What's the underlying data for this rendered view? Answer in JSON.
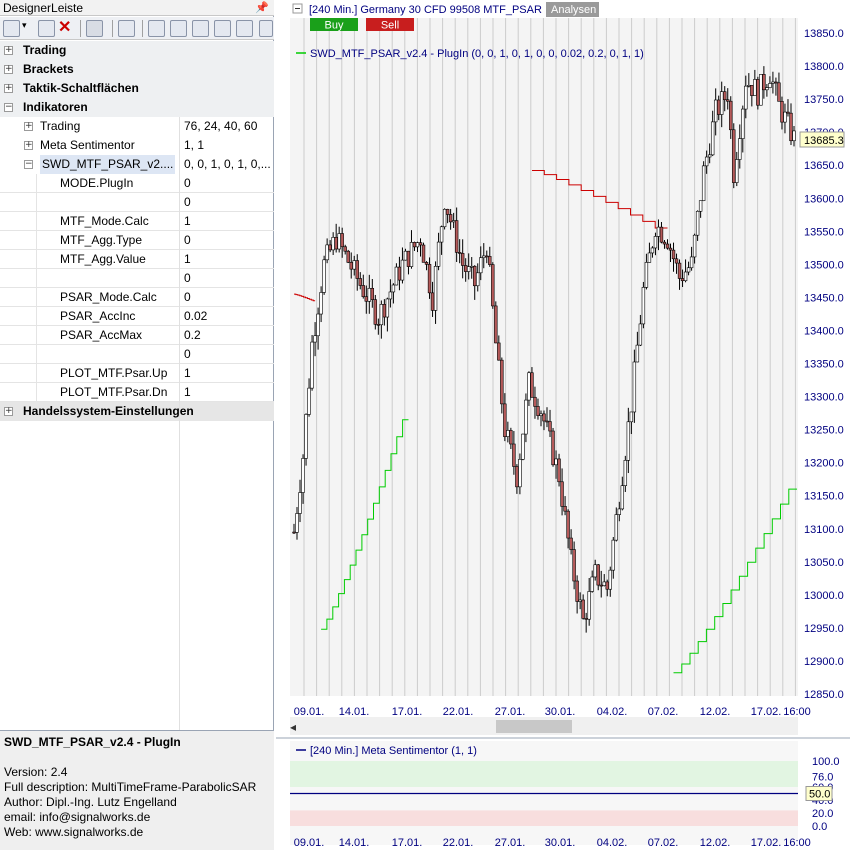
{
  "panel": {
    "title": "DesignerLeiste",
    "tree": [
      {
        "label": "Trading",
        "value": "",
        "level": 0,
        "expander": "+",
        "bold": true
      },
      {
        "label": "Brackets",
        "value": "",
        "level": 0,
        "expander": "+",
        "bold": true
      },
      {
        "label": "Taktik-Schaltflächen",
        "value": "",
        "level": 0,
        "expander": "+",
        "bold": true
      },
      {
        "label": "Indikatoren",
        "value": "",
        "level": 0,
        "expander": "-",
        "bold": true
      },
      {
        "label": "Trading",
        "value": "76, 24, 40, 60",
        "level": 1,
        "expander": "+",
        "bold": false
      },
      {
        "label": "Meta Sentimentor",
        "value": "1, 1",
        "level": 1,
        "expander": "+",
        "bold": false
      },
      {
        "label": "SWD_MTF_PSAR_v2....",
        "value": "0, 0, 1, 0, 1, 0,...",
        "level": 1,
        "expander": "-",
        "bold": false,
        "selected": true
      },
      {
        "label": "MODE.PlugIn",
        "value": "0",
        "level": 2,
        "expander": "",
        "bold": false
      },
      {
        "label": "",
        "value": "0",
        "level": 2,
        "expander": "",
        "bold": false
      },
      {
        "label": "MTF_Mode.Calc",
        "value": "1",
        "level": 2,
        "expander": "",
        "bold": false
      },
      {
        "label": "MTF_Agg.Type",
        "value": "0",
        "level": 2,
        "expander": "",
        "bold": false
      },
      {
        "label": "MTF_Agg.Value",
        "value": "1",
        "level": 2,
        "expander": "",
        "bold": false
      },
      {
        "label": "",
        "value": "0",
        "level": 2,
        "expander": "",
        "bold": false
      },
      {
        "label": "PSAR_Mode.Calc",
        "value": "0",
        "level": 2,
        "expander": "",
        "bold": false
      },
      {
        "label": "PSAR_AccInc",
        "value": "0.02",
        "level": 2,
        "expander": "",
        "bold": false
      },
      {
        "label": "PSAR_AccMax",
        "value": "0.2",
        "level": 2,
        "expander": "",
        "bold": false
      },
      {
        "label": "",
        "value": "0",
        "level": 2,
        "expander": "",
        "bold": false
      },
      {
        "label": "PLOT_MTF.Psar.Up",
        "value": "1",
        "level": 2,
        "expander": "",
        "bold": false
      },
      {
        "label": "PLOT_MTF.Psar.Dn",
        "value": "1",
        "level": 2,
        "expander": "",
        "bold": false
      },
      {
        "label": "Handelssystem-Einstellungen",
        "value": "",
        "level": 0,
        "expander": "+",
        "bold": true
      }
    ]
  },
  "description": {
    "title": "SWD_MTF_PSAR_v2.4 - PlugIn",
    "lines": [
      "Version: 2.4",
      "Full description: MultiTimeFrame-ParabolicSAR",
      "Author: Dipl.-Ing. Lutz Engelland",
      "email: info@signalworks.de",
      "Web: www.signalworks.de"
    ]
  },
  "chart": {
    "header": "[240 Min.] Germany 30 CFD   99508 MTF_PSAR",
    "analysen_label": "Analysen",
    "buy_label": "Buy",
    "sell_label": "Sell",
    "legend": "SWD_MTF_PSAR_v2.4 - PlugIn  (0, 0, 1, 0, 1, 0, 0, 0.02, 0.2, 0, 1, 1)",
    "last_price": "13685.3",
    "x_ticks": [
      "09.01.",
      "14.01.",
      "17.01.",
      "22.01.",
      "27.01.",
      "30.01.",
      "04.02.",
      "07.02.",
      "12.02.",
      "17.02."
    ],
    "x_last_time": "16:00",
    "sub_header": "[240 Min.] Meta Sentimentor  (1, 1)",
    "sub_last": "50.0",
    "colors": {
      "up_candle": "#ffffff",
      "down_candle": "#b55a5a",
      "psar_up": "#00cc00",
      "psar_dn": "#cc0000",
      "sentiment_line": "#000080"
    }
  },
  "chart_data": [
    {
      "type": "candlestick",
      "y_ticks": [
        12850,
        12900,
        12950,
        13000,
        13050,
        13100,
        13150,
        13200,
        13250,
        13300,
        13350,
        13400,
        13450,
        13500,
        13550,
        13600,
        13650,
        13700,
        13750,
        13800,
        13850
      ],
      "ylim": [
        12840,
        13860
      ],
      "keypoints": [
        {
          "i": 0,
          "v": 13095
        },
        {
          "i": 3,
          "v": 13210
        },
        {
          "i": 6,
          "v": 13380
        },
        {
          "i": 10,
          "v": 13500
        },
        {
          "i": 14,
          "v": 13540
        },
        {
          "i": 22,
          "v": 13470
        },
        {
          "i": 28,
          "v": 13420
        },
        {
          "i": 36,
          "v": 13500
        },
        {
          "i": 42,
          "v": 13540
        },
        {
          "i": 46,
          "v": 13450
        },
        {
          "i": 50,
          "v": 13600
        },
        {
          "i": 56,
          "v": 13500
        },
        {
          "i": 60,
          "v": 13470
        },
        {
          "i": 64,
          "v": 13530
        },
        {
          "i": 67,
          "v": 13380
        },
        {
          "i": 70,
          "v": 13250
        },
        {
          "i": 74,
          "v": 13180
        },
        {
          "i": 78,
          "v": 13320
        },
        {
          "i": 82,
          "v": 13280
        },
        {
          "i": 88,
          "v": 13180
        },
        {
          "i": 92,
          "v": 13050
        },
        {
          "i": 96,
          "v": 12960
        },
        {
          "i": 100,
          "v": 13030
        },
        {
          "i": 104,
          "v": 13010
        },
        {
          "i": 108,
          "v": 13150
        },
        {
          "i": 112,
          "v": 13290
        },
        {
          "i": 116,
          "v": 13460
        },
        {
          "i": 120,
          "v": 13560
        },
        {
          "i": 124,
          "v": 13540
        },
        {
          "i": 128,
          "v": 13480
        },
        {
          "i": 132,
          "v": 13500
        },
        {
          "i": 136,
          "v": 13640
        },
        {
          "i": 140,
          "v": 13730
        },
        {
          "i": 144,
          "v": 13760
        },
        {
          "i": 146,
          "v": 13640
        },
        {
          "i": 150,
          "v": 13780
        },
        {
          "i": 154,
          "v": 13760
        },
        {
          "i": 158,
          "v": 13790
        },
        {
          "i": 161,
          "v": 13740
        },
        {
          "i": 166,
          "v": 13690
        }
      ],
      "bar_count": 167
    },
    {
      "type": "step",
      "name": "PSAR up",
      "segments": [
        {
          "from": 9,
          "to": 38,
          "start": 12948,
          "end": 13265
        },
        {
          "from": 126,
          "to": 167,
          "start": 12882,
          "end": 13160
        }
      ]
    },
    {
      "type": "step",
      "name": "PSAR down",
      "segments": [
        {
          "from": 0,
          "to": 7,
          "start": 13455,
          "end": 13445
        },
        {
          "from": 79,
          "to": 124,
          "start": 13642,
          "end": 13555
        }
      ]
    },
    {
      "type": "line",
      "name": "Meta Sentimentor",
      "y_ticks": [
        0.0,
        20.0,
        40.0,
        50.0,
        60.0,
        76.0,
        100.0
      ],
      "ylim": [
        0,
        100
      ],
      "zones": [
        {
          "from": 60,
          "to": 100,
          "color": "#e2f5e2"
        },
        {
          "from": 0,
          "to": 24,
          "color": "#f8dede"
        }
      ],
      "values": [
        50.0
      ]
    }
  ]
}
